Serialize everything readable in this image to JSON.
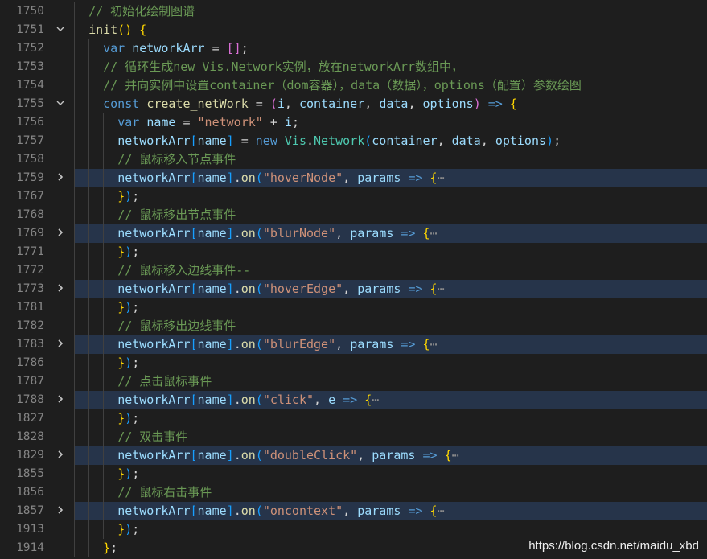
{
  "lines": [
    {
      "num": "1750",
      "fold": "",
      "tokens": [
        [
          "c-comment",
          "// 初始化绘制图谱"
        ]
      ],
      "indent": 2
    },
    {
      "num": "1751",
      "fold": "chevron-down",
      "tokens": [
        [
          "c-fn",
          "init"
        ],
        [
          "c-br1",
          "()"
        ],
        [
          "c-plain",
          " "
        ],
        [
          "c-br1",
          "{"
        ]
      ],
      "indent": 2
    },
    {
      "num": "1752",
      "fold": "",
      "tokens": [
        [
          "c-kw",
          "var"
        ],
        [
          "c-plain",
          " "
        ],
        [
          "c-var",
          "networkArr"
        ],
        [
          "c-plain",
          " = "
        ],
        [
          "c-br2",
          "[]"
        ],
        [
          "c-plain",
          ";"
        ]
      ],
      "indent": 3
    },
    {
      "num": "1753",
      "fold": "",
      "tokens": [
        [
          "c-comment",
          "// 循环生成new Vis.Network实例，放在networkArr数组中，"
        ]
      ],
      "indent": 3
    },
    {
      "num": "1754",
      "fold": "",
      "tokens": [
        [
          "c-comment",
          "// 并向实例中设置container（dom容器），data（数据），options（配置）参数绘图"
        ]
      ],
      "indent": 3
    },
    {
      "num": "1755",
      "fold": "chevron-down",
      "tokens": [
        [
          "c-kw",
          "const"
        ],
        [
          "c-plain",
          " "
        ],
        [
          "c-fn",
          "create_netWork"
        ],
        [
          "c-plain",
          " = "
        ],
        [
          "c-br2",
          "("
        ],
        [
          "c-var",
          "i"
        ],
        [
          "c-plain",
          ", "
        ],
        [
          "c-var",
          "container"
        ],
        [
          "c-plain",
          ", "
        ],
        [
          "c-var",
          "data"
        ],
        [
          "c-plain",
          ", "
        ],
        [
          "c-var",
          "options"
        ],
        [
          "c-br2",
          ")"
        ],
        [
          "c-plain",
          " "
        ],
        [
          "c-kw",
          "=>"
        ],
        [
          "c-plain",
          " "
        ],
        [
          "c-br1",
          "{"
        ]
      ],
      "indent": 3
    },
    {
      "num": "1756",
      "fold": "",
      "tokens": [
        [
          "c-kw",
          "var"
        ],
        [
          "c-plain",
          " "
        ],
        [
          "c-var",
          "name"
        ],
        [
          "c-plain",
          " = "
        ],
        [
          "c-str",
          "\"network\""
        ],
        [
          "c-plain",
          " + "
        ],
        [
          "c-var",
          "i"
        ],
        [
          "c-plain",
          ";"
        ]
      ],
      "indent": 4
    },
    {
      "num": "1757",
      "fold": "",
      "tokens": [
        [
          "c-var",
          "networkArr"
        ],
        [
          "c-br3",
          "["
        ],
        [
          "c-var",
          "name"
        ],
        [
          "c-br3",
          "]"
        ],
        [
          "c-plain",
          " = "
        ],
        [
          "c-kw",
          "new"
        ],
        [
          "c-plain",
          " "
        ],
        [
          "c-class",
          "Vis"
        ],
        [
          "c-plain",
          "."
        ],
        [
          "c-class",
          "Network"
        ],
        [
          "c-br3",
          "("
        ],
        [
          "c-var",
          "container"
        ],
        [
          "c-plain",
          ", "
        ],
        [
          "c-var",
          "data"
        ],
        [
          "c-plain",
          ", "
        ],
        [
          "c-var",
          "options"
        ],
        [
          "c-br3",
          ")"
        ],
        [
          "c-plain",
          ";"
        ]
      ],
      "indent": 4
    },
    {
      "num": "1758",
      "fold": "",
      "tokens": [
        [
          "c-comment",
          "// 鼠标移入节点事件"
        ]
      ],
      "indent": 4
    },
    {
      "num": "1759",
      "fold": "chevron-right",
      "folded": true,
      "tokens": [
        [
          "c-var",
          "networkArr"
        ],
        [
          "c-br3",
          "["
        ],
        [
          "c-var",
          "name"
        ],
        [
          "c-br3",
          "]"
        ],
        [
          "c-plain",
          "."
        ],
        [
          "c-fn",
          "on"
        ],
        [
          "c-br3",
          "("
        ],
        [
          "c-str",
          "\"hoverNode\""
        ],
        [
          "c-plain",
          ", "
        ],
        [
          "c-var",
          "params"
        ],
        [
          "c-plain",
          " "
        ],
        [
          "c-kw",
          "=>"
        ],
        [
          "c-plain",
          " "
        ],
        [
          "c-br1",
          "{"
        ],
        [
          "c-ell",
          "⋯"
        ]
      ],
      "indent": 4
    },
    {
      "num": "1767",
      "fold": "",
      "tokens": [
        [
          "c-br1",
          "}"
        ],
        [
          "c-br3",
          ")"
        ],
        [
          "c-plain",
          ";"
        ]
      ],
      "indent": 4
    },
    {
      "num": "1768",
      "fold": "",
      "tokens": [
        [
          "c-comment",
          "// 鼠标移出节点事件"
        ]
      ],
      "indent": 4
    },
    {
      "num": "1769",
      "fold": "chevron-right",
      "folded": true,
      "tokens": [
        [
          "c-var",
          "networkArr"
        ],
        [
          "c-br3",
          "["
        ],
        [
          "c-var",
          "name"
        ],
        [
          "c-br3",
          "]"
        ],
        [
          "c-plain",
          "."
        ],
        [
          "c-fn",
          "on"
        ],
        [
          "c-br3",
          "("
        ],
        [
          "c-str",
          "\"blurNode\""
        ],
        [
          "c-plain",
          ", "
        ],
        [
          "c-var",
          "params"
        ],
        [
          "c-plain",
          " "
        ],
        [
          "c-kw",
          "=>"
        ],
        [
          "c-plain",
          " "
        ],
        [
          "c-br1",
          "{"
        ],
        [
          "c-ell",
          "⋯"
        ]
      ],
      "indent": 4
    },
    {
      "num": "1771",
      "fold": "",
      "tokens": [
        [
          "c-br1",
          "}"
        ],
        [
          "c-br3",
          ")"
        ],
        [
          "c-plain",
          ";"
        ]
      ],
      "indent": 4
    },
    {
      "num": "1772",
      "fold": "",
      "tokens": [
        [
          "c-comment",
          "// 鼠标移入边线事件--"
        ]
      ],
      "indent": 4
    },
    {
      "num": "1773",
      "fold": "chevron-right",
      "folded": true,
      "tokens": [
        [
          "c-var",
          "networkArr"
        ],
        [
          "c-br3",
          "["
        ],
        [
          "c-var",
          "name"
        ],
        [
          "c-br3",
          "]"
        ],
        [
          "c-plain",
          "."
        ],
        [
          "c-fn",
          "on"
        ],
        [
          "c-br3",
          "("
        ],
        [
          "c-str",
          "\"hoverEdge\""
        ],
        [
          "c-plain",
          ", "
        ],
        [
          "c-var",
          "params"
        ],
        [
          "c-plain",
          " "
        ],
        [
          "c-kw",
          "=>"
        ],
        [
          "c-plain",
          " "
        ],
        [
          "c-br1",
          "{"
        ],
        [
          "c-ell",
          "⋯"
        ]
      ],
      "indent": 4
    },
    {
      "num": "1781",
      "fold": "",
      "tokens": [
        [
          "c-br1",
          "}"
        ],
        [
          "c-br3",
          ")"
        ],
        [
          "c-plain",
          ";"
        ]
      ],
      "indent": 4
    },
    {
      "num": "1782",
      "fold": "",
      "tokens": [
        [
          "c-comment",
          "// 鼠标移出边线事件"
        ]
      ],
      "indent": 4
    },
    {
      "num": "1783",
      "fold": "chevron-right",
      "folded": true,
      "tokens": [
        [
          "c-var",
          "networkArr"
        ],
        [
          "c-br3",
          "["
        ],
        [
          "c-var",
          "name"
        ],
        [
          "c-br3",
          "]"
        ],
        [
          "c-plain",
          "."
        ],
        [
          "c-fn",
          "on"
        ],
        [
          "c-br3",
          "("
        ],
        [
          "c-str",
          "\"blurEdge\""
        ],
        [
          "c-plain",
          ", "
        ],
        [
          "c-var",
          "params"
        ],
        [
          "c-plain",
          " "
        ],
        [
          "c-kw",
          "=>"
        ],
        [
          "c-plain",
          " "
        ],
        [
          "c-br1",
          "{"
        ],
        [
          "c-ell",
          "⋯"
        ]
      ],
      "indent": 4
    },
    {
      "num": "1786",
      "fold": "",
      "tokens": [
        [
          "c-br1",
          "}"
        ],
        [
          "c-br3",
          ")"
        ],
        [
          "c-plain",
          ";"
        ]
      ],
      "indent": 4
    },
    {
      "num": "1787",
      "fold": "",
      "tokens": [
        [
          "c-comment",
          "// 点击鼠标事件"
        ]
      ],
      "indent": 4
    },
    {
      "num": "1788",
      "fold": "chevron-right",
      "folded": true,
      "tokens": [
        [
          "c-var",
          "networkArr"
        ],
        [
          "c-br3",
          "["
        ],
        [
          "c-var",
          "name"
        ],
        [
          "c-br3",
          "]"
        ],
        [
          "c-plain",
          "."
        ],
        [
          "c-fn",
          "on"
        ],
        [
          "c-br3",
          "("
        ],
        [
          "c-str",
          "\"click\""
        ],
        [
          "c-plain",
          ", "
        ],
        [
          "c-var",
          "e"
        ],
        [
          "c-plain",
          " "
        ],
        [
          "c-kw",
          "=>"
        ],
        [
          "c-plain",
          " "
        ],
        [
          "c-br1",
          "{"
        ],
        [
          "c-ell",
          "⋯"
        ]
      ],
      "indent": 4
    },
    {
      "num": "1827",
      "fold": "",
      "tokens": [
        [
          "c-br1",
          "}"
        ],
        [
          "c-br3",
          ")"
        ],
        [
          "c-plain",
          ";"
        ]
      ],
      "indent": 4
    },
    {
      "num": "1828",
      "fold": "",
      "tokens": [
        [
          "c-comment",
          "// 双击事件"
        ]
      ],
      "indent": 4
    },
    {
      "num": "1829",
      "fold": "chevron-right",
      "folded": true,
      "tokens": [
        [
          "c-var",
          "networkArr"
        ],
        [
          "c-br3",
          "["
        ],
        [
          "c-var",
          "name"
        ],
        [
          "c-br3",
          "]"
        ],
        [
          "c-plain",
          "."
        ],
        [
          "c-fn",
          "on"
        ],
        [
          "c-br3",
          "("
        ],
        [
          "c-str",
          "\"doubleClick\""
        ],
        [
          "c-plain",
          ", "
        ],
        [
          "c-var",
          "params"
        ],
        [
          "c-plain",
          " "
        ],
        [
          "c-kw",
          "=>"
        ],
        [
          "c-plain",
          " "
        ],
        [
          "c-br1",
          "{"
        ],
        [
          "c-ell",
          "⋯"
        ]
      ],
      "indent": 4
    },
    {
      "num": "1855",
      "fold": "",
      "tokens": [
        [
          "c-br1",
          "}"
        ],
        [
          "c-br3",
          ")"
        ],
        [
          "c-plain",
          ";"
        ]
      ],
      "indent": 4
    },
    {
      "num": "1856",
      "fold": "",
      "tokens": [
        [
          "c-comment",
          "// 鼠标右击事件"
        ]
      ],
      "indent": 4
    },
    {
      "num": "1857",
      "fold": "chevron-right",
      "folded": true,
      "tokens": [
        [
          "c-var",
          "networkArr"
        ],
        [
          "c-br3",
          "["
        ],
        [
          "c-var",
          "name"
        ],
        [
          "c-br3",
          "]"
        ],
        [
          "c-plain",
          "."
        ],
        [
          "c-fn",
          "on"
        ],
        [
          "c-br3",
          "("
        ],
        [
          "c-str",
          "\"oncontext\""
        ],
        [
          "c-plain",
          ", "
        ],
        [
          "c-var",
          "params"
        ],
        [
          "c-plain",
          " "
        ],
        [
          "c-kw",
          "=>"
        ],
        [
          "c-plain",
          " "
        ],
        [
          "c-br1",
          "{"
        ],
        [
          "c-ell",
          "⋯"
        ]
      ],
      "indent": 4
    },
    {
      "num": "1913",
      "fold": "",
      "tokens": [
        [
          "c-br1",
          "}"
        ],
        [
          "c-br3",
          ")"
        ],
        [
          "c-plain",
          ";"
        ]
      ],
      "indent": 4
    },
    {
      "num": "1914",
      "fold": "",
      "tokens": [
        [
          "c-br1",
          "}"
        ],
        [
          "c-plain",
          ";"
        ]
      ],
      "indent": 3
    }
  ],
  "watermark": "https://blog.csdn.net/maidu_xbd"
}
